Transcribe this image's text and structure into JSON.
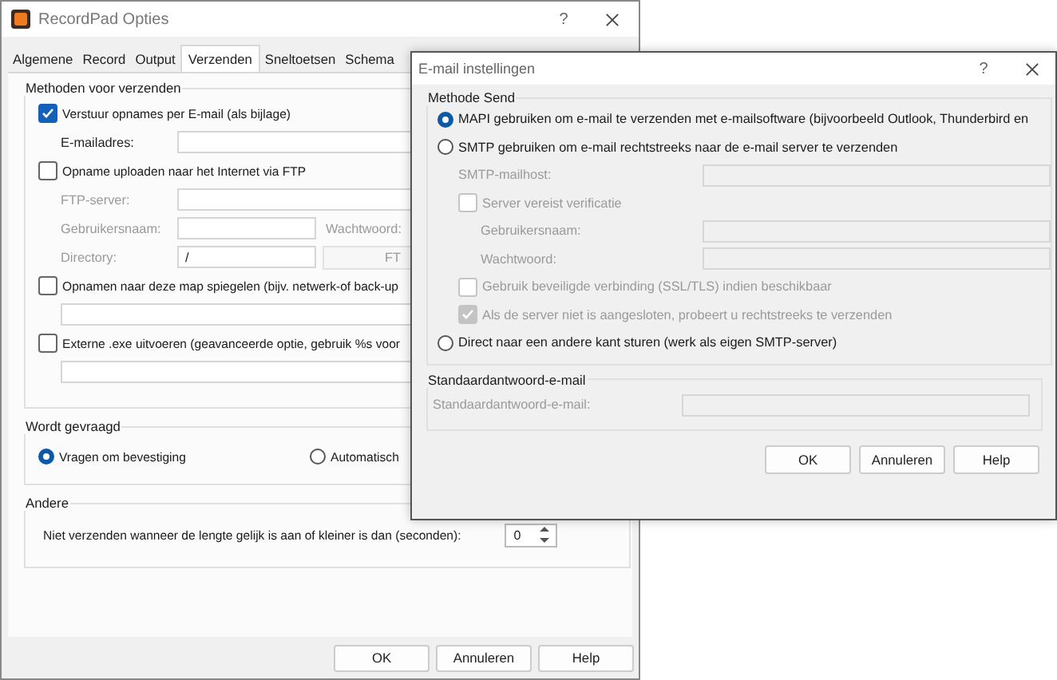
{
  "main_window": {
    "title": "RecordPad Opties",
    "help": "?",
    "tabs": [
      {
        "label": "Algemene",
        "selected": false
      },
      {
        "label": "Record",
        "selected": false
      },
      {
        "label": "Output",
        "selected": false
      },
      {
        "label": "Verzenden",
        "selected": true
      },
      {
        "label": "Sneltoetsen",
        "selected": false
      },
      {
        "label": "Schema",
        "selected": false
      }
    ],
    "methods_group": {
      "title": "Methoden voor verzenden",
      "email": {
        "label": "Verstuur opnames per E-mail (als bijlage)",
        "checked": true,
        "address_label": "E-mailadres:"
      },
      "ftp": {
        "label": "Opname uploaden naar het Internet via FTP",
        "checked": false,
        "server_label": "FTP-server:",
        "user_label": "Gebruikersnaam:",
        "password_label": "Wachtwoord:",
        "directory_label": "Directory:",
        "directory_value": "/",
        "button": "FT"
      },
      "mirror": {
        "label": "Opnamen naar deze map spiegelen (bijv. netwerk-of back-up",
        "checked": false
      },
      "external": {
        "label": "Externe .exe uitvoeren (geavanceerde optie, gebruik %s voor",
        "checked": false
      }
    },
    "ask_group": {
      "title": "Wordt gevraagd",
      "options": [
        {
          "label": "Vragen om bevestiging",
          "selected": true
        },
        {
          "label": "Automatisch",
          "selected": false
        }
      ]
    },
    "other_group": {
      "title": "Andere",
      "label": "Niet verzenden wanneer de lengte gelijk is aan of kleiner is dan (seconden):",
      "value": "0"
    },
    "buttons": [
      "OK",
      "Annuleren",
      "Help"
    ]
  },
  "dialog": {
    "title": "E-mail instellingen",
    "help": "?",
    "method_group": {
      "title": "Methode Send",
      "options": [
        {
          "label": "MAPI gebruiken om e-mail te verzenden met e-mailsoftware (bijvoorbeeld Outlook, Thunderbird en",
          "selected": true
        },
        {
          "label": "SMTP gebruiken om e-mail rechtstreeks naar de e-mail server te verzenden",
          "selected": false
        },
        {
          "label": "Direct naar een andere kant sturen (werk als eigen SMTP-server)",
          "selected": false
        }
      ],
      "smtp_host_label": "SMTP-mailhost:",
      "auth": {
        "label": "Server vereist verificatie",
        "checked": false,
        "disabled": true
      },
      "user_label": "Gebruikersnaam:",
      "password_label": "Wachtwoord:",
      "ssl": {
        "label": "Gebruik beveiligde verbinding (SSL/TLS) indien beschikbaar",
        "checked": false,
        "disabled": true
      },
      "fallback": {
        "label": "Als de server niet is aangesloten, probeert u rechtstreeks te verzenden",
        "checked": true,
        "disabled": true
      }
    },
    "reply_group": {
      "title": "Standaardantwoord-e-mail",
      "label": "Standaardantwoord-e-mail:"
    },
    "buttons": [
      "OK",
      "Annuleren",
      "Help"
    ]
  }
}
